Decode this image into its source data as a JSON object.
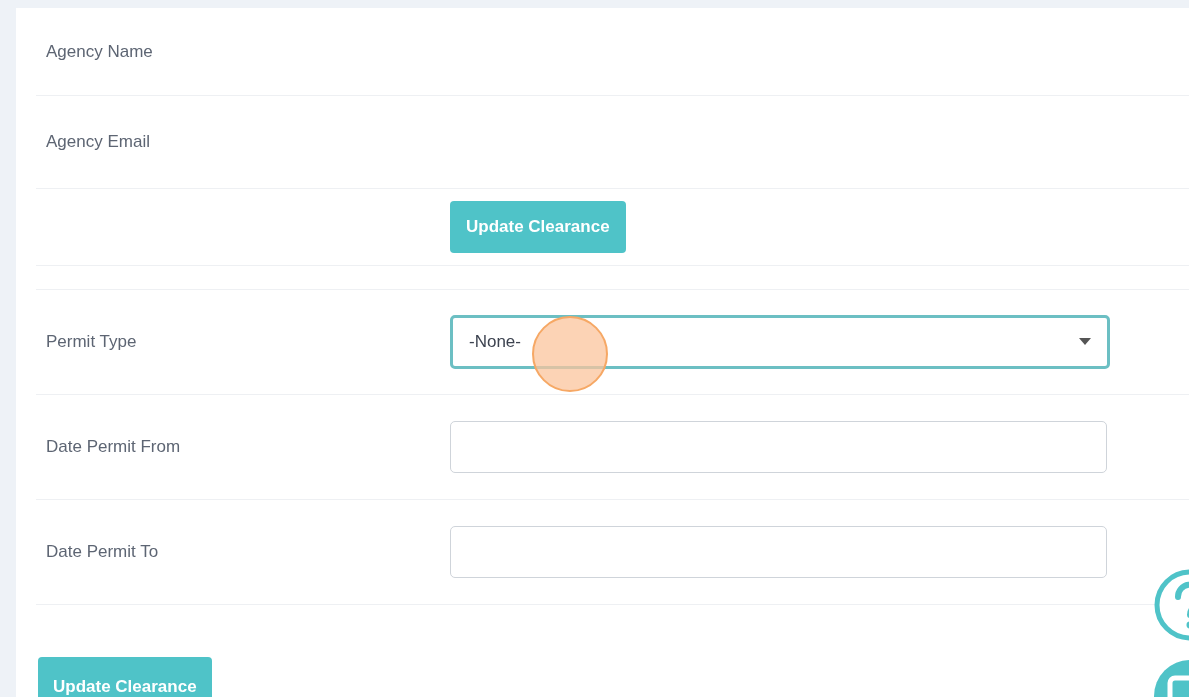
{
  "rows": [
    {
      "kind": "text",
      "label": "Agency Name"
    },
    {
      "kind": "text",
      "label": "Agency Email"
    },
    {
      "kind": "button",
      "button": "Update Clearance"
    },
    {
      "kind": "spacer"
    },
    {
      "kind": "select",
      "label": "Permit Type",
      "value": "-None-",
      "focused": true
    },
    {
      "kind": "input",
      "label": "Date Permit From",
      "focused": false
    },
    {
      "kind": "input",
      "label": "Date Permit To",
      "focused": false
    }
  ],
  "footer_button": "Update Clearance"
}
